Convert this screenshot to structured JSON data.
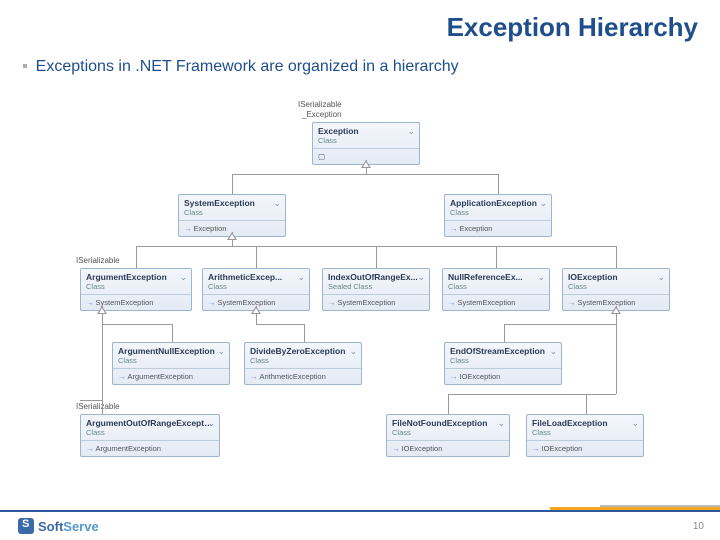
{
  "title": "Exception Hierarchy",
  "bullet": "Exceptions in .NET Framework are organized in a hierarchy",
  "labels": {
    "iser1": "ISerializable",
    "excUnder": "_Exception",
    "iser2": "ISerializable",
    "iser3": "ISerializable"
  },
  "boxes": {
    "exception": {
      "name": "Exception",
      "sub": "Class",
      "base": ""
    },
    "system": {
      "name": "SystemException",
      "sub": "Class",
      "base": "Exception"
    },
    "app": {
      "name": "ApplicationException",
      "sub": "Class",
      "base": "Exception"
    },
    "arg": {
      "name": "ArgumentException",
      "sub": "Class",
      "base": "SystemException"
    },
    "arith": {
      "name": "ArithmeticExcep...",
      "sub": "Class",
      "base": "SystemException"
    },
    "index": {
      "name": "IndexOutOfRangeEx...",
      "sub": "Sealed Class",
      "base": "SystemException"
    },
    "nullref": {
      "name": "NullReferenceEx...",
      "sub": "Class",
      "base": "SystemException"
    },
    "io": {
      "name": "IOException",
      "sub": "Class",
      "base": "SystemException"
    },
    "argnull": {
      "name": "ArgumentNullException",
      "sub": "Class",
      "base": "ArgumentException"
    },
    "divzero": {
      "name": "DivideByZeroException",
      "sub": "Class",
      "base": "ArithmeticException"
    },
    "eos": {
      "name": "EndOfStreamException",
      "sub": "Class",
      "base": "IOException"
    },
    "argoor": {
      "name": "ArgumentOutOfRangeException",
      "sub": "Class",
      "base": "ArgumentException"
    },
    "fnf": {
      "name": "FileNotFoundException",
      "sub": "Class",
      "base": "IOException"
    },
    "fload": {
      "name": "FileLoadException",
      "sub": "Class",
      "base": "IOException"
    }
  },
  "footer": {
    "brand1": "Soft",
    "brand2": "Serve"
  },
  "page": "10"
}
